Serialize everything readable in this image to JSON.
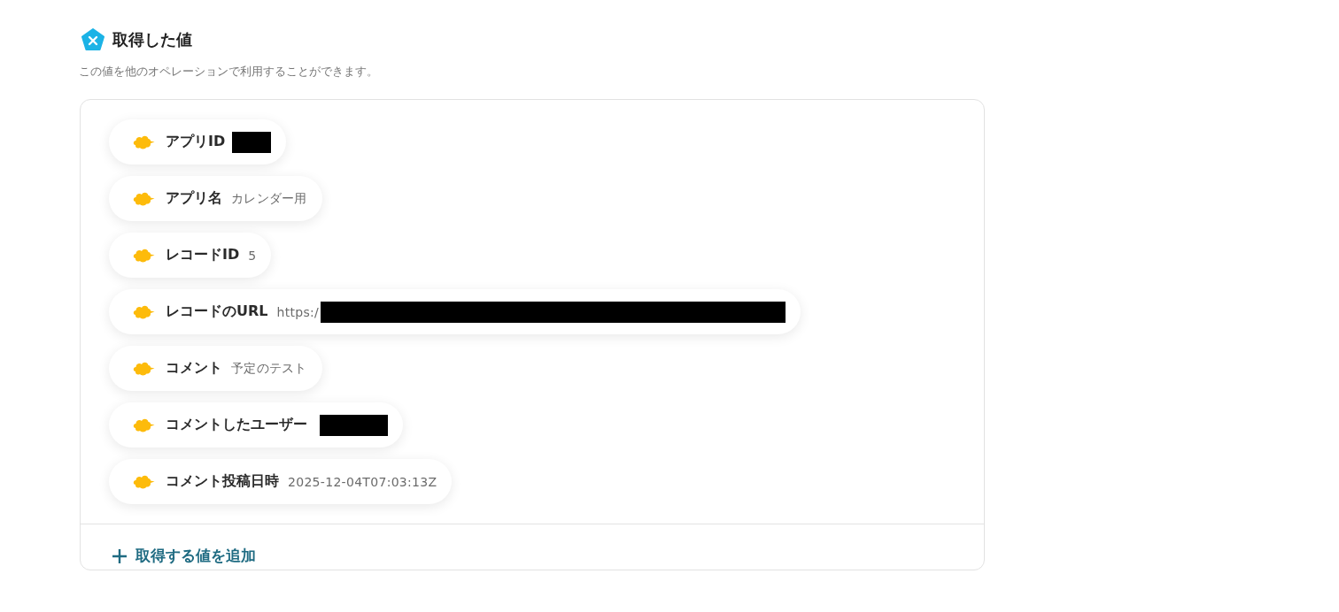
{
  "header": {
    "title": "取得した値",
    "description": "この値を他のオペレーションで利用することができます。"
  },
  "values": [
    {
      "label": "アプリID",
      "redacted": true
    },
    {
      "label": "アプリ名",
      "value": "カレンダー用",
      "redacted": false
    },
    {
      "label": "レコードID",
      "value": "5",
      "redacted": false
    },
    {
      "label": "レコードのURL",
      "value": "https:/",
      "redacted": true
    },
    {
      "label": "コメント",
      "value": "予定のテスト",
      "redacted": false
    },
    {
      "label": "コメントしたユーザー",
      "redacted": true
    },
    {
      "label": "コメント投稿日時",
      "value": "2025-12-04T07:03:13Z",
      "redacted": false
    }
  ],
  "add_button": {
    "label": "取得する値を追加"
  }
}
